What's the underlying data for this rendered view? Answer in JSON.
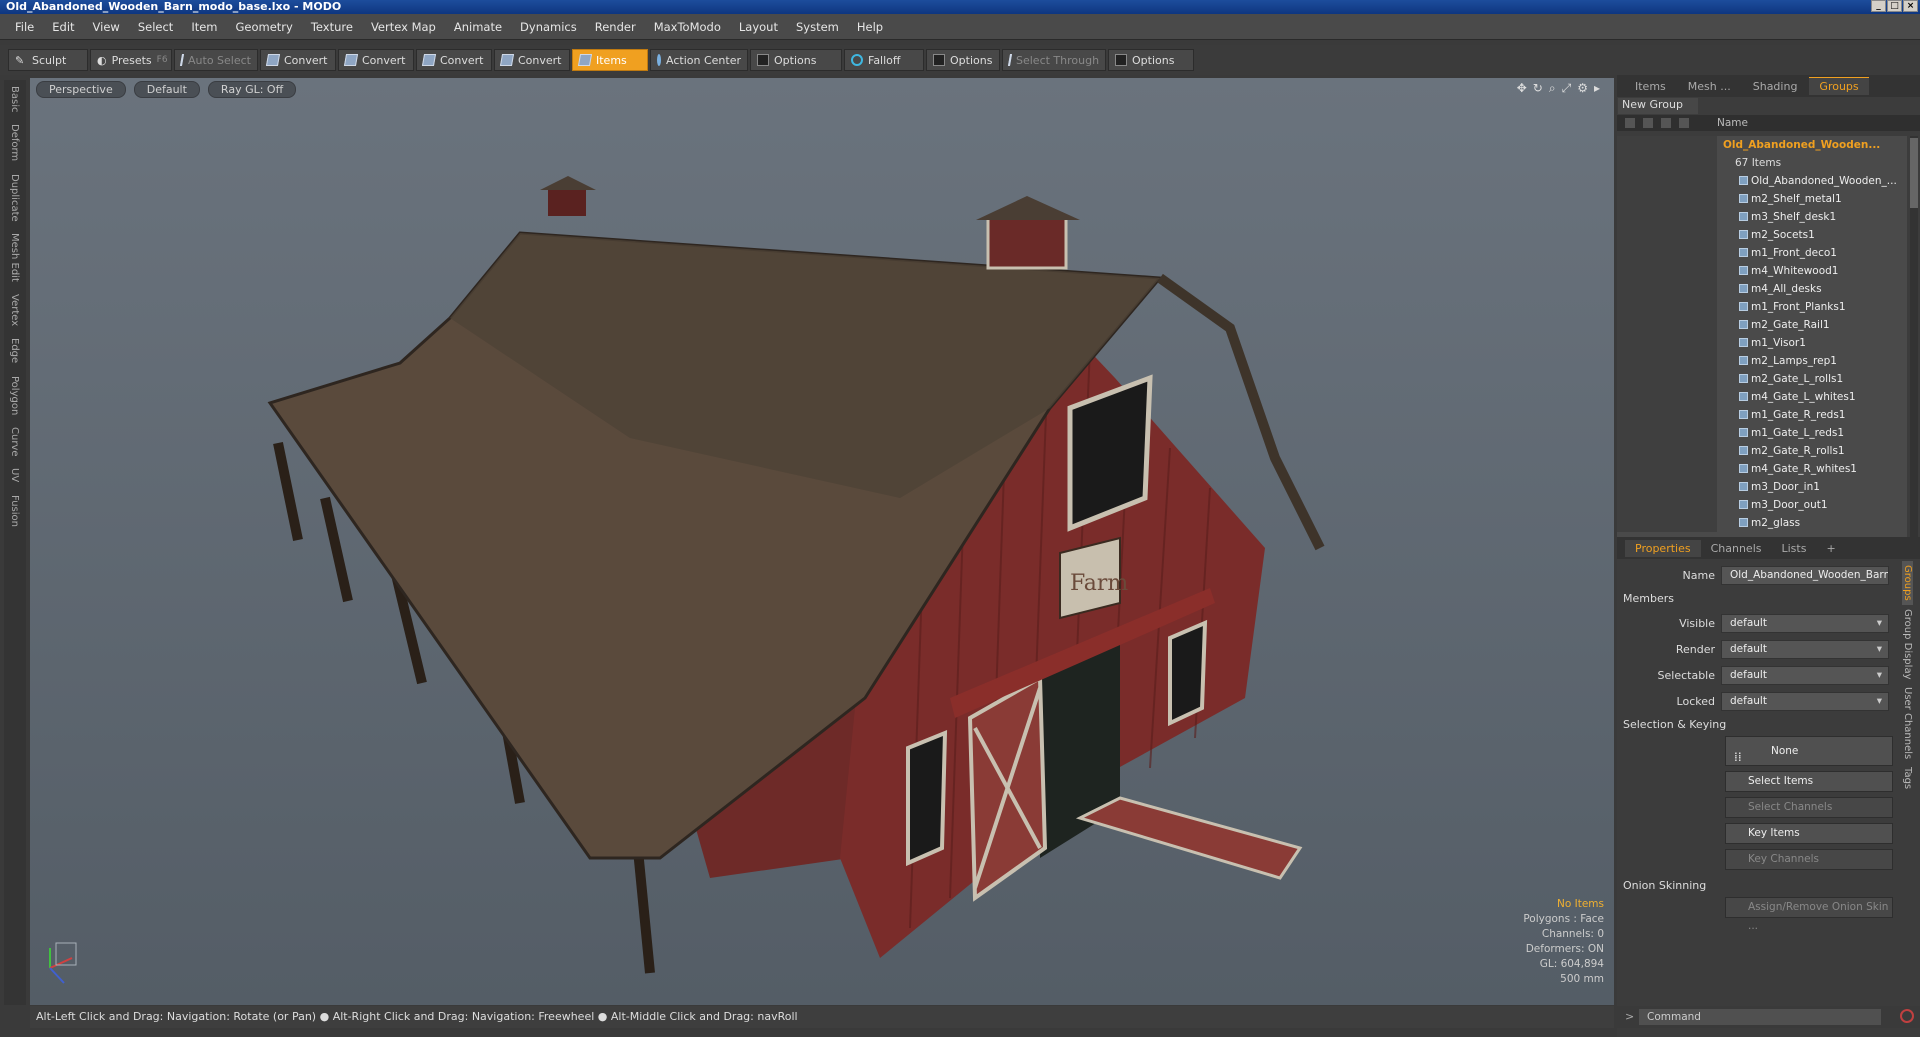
{
  "window": {
    "title": "Old_Abandoned_Wooden_Barn_modo_base.lxo - MODO"
  },
  "menu": [
    "File",
    "Edit",
    "View",
    "Select",
    "Item",
    "Geometry",
    "Texture",
    "Vertex Map",
    "Animate",
    "Dynamics",
    "Render",
    "MaxToModo",
    "Layout",
    "System",
    "Help"
  ],
  "toolbar": {
    "sculpt": "Sculpt",
    "presets": "Presets",
    "presets_key": "F6",
    "auto_select": "Auto Select",
    "convert": "Convert",
    "items": "Items",
    "action_center": "Action Center",
    "options": "Options",
    "falloff": "Falloff",
    "select_through": "Select Through"
  },
  "left_tabs": [
    "Basic",
    "Deform",
    "Duplicate",
    "Mesh Edit",
    "Vertex",
    "Edge",
    "Polygon",
    "Curve",
    "UV",
    "Fusion"
  ],
  "viewport": {
    "view": "Perspective",
    "shading": "Default",
    "raygl": "Ray GL: Off",
    "stats": {
      "no_items": "No Items",
      "polygons": "Polygons : Face",
      "channels": "Channels: 0",
      "deformers": "Deformers: ON",
      "gl": "GL: 604,894",
      "scale": "500 mm"
    }
  },
  "statusbar": "Alt-Left Click and Drag: Navigation: Rotate (or Pan) ● Alt-Right Click and Drag: Navigation: Freewheel ● Alt-Middle Click and Drag: navRoll",
  "panel": {
    "tabs": [
      "Items",
      "Mesh ...",
      "Shading",
      "Groups"
    ],
    "new_group": "New Group",
    "name_header": "Name",
    "group_name": "Old_Abandoned_Wooden...",
    "group_count": "67 Items",
    "items": [
      "Old_Abandoned_Wooden_...",
      "m2_Shelf_metal1",
      "m3_Shelf_desk1",
      "m2_Socets1",
      "m1_Front_deco1",
      "m4_Whitewood1",
      "m4_All_desks",
      "m1_Front_Planks1",
      "m2_Gate_Rail1",
      "m1_Visor1",
      "m2_Lamps_rep1",
      "m2_Gate_L_rolls1",
      "m4_Gate_L_whites1",
      "m1_Gate_R_reds1",
      "m1_Gate_L_reds1",
      "m2_Gate_R_rolls1",
      "m4_Gate_R_whites1",
      "m3_Door_in1",
      "m3_Door_out1",
      "m2_glass"
    ]
  },
  "properties": {
    "tabs": [
      "Properties",
      "Channels",
      "Lists"
    ],
    "name_label": "Name",
    "name_value": "Old_Abandoned_Wooden_Barn (",
    "members": "Members",
    "visible_label": "Visible",
    "visible": "default",
    "render_label": "Render",
    "render": "default",
    "selectable_label": "Selectable",
    "selectable": "default",
    "locked_label": "Locked",
    "locked": "default",
    "sel_keying": "Selection & Keying",
    "none": "None",
    "select_items": "Select Items",
    "select_channels": "Select Channels",
    "key_items": "Key Items",
    "key_channels": "Key Channels",
    "onion": "Onion Skinning",
    "assign_onion": "Assign/Remove Onion Skin ...",
    "side_tabs": [
      "Groups",
      "Group Display",
      "User Channels",
      "Tags"
    ]
  },
  "command": {
    "placeholder": "Command"
  }
}
